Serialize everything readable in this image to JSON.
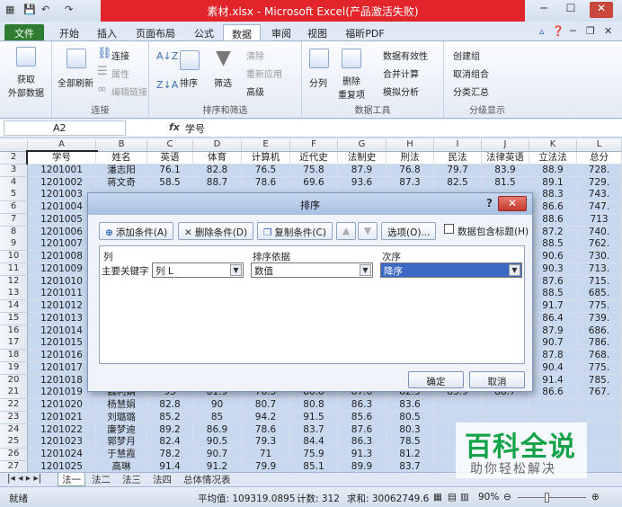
{
  "window": {
    "title": "素材.xlsx - Microsoft Excel(产品激活失败)",
    "qa_save": "💾",
    "qa_undo": "↶",
    "qa_redo": "↷",
    "min": "─",
    "max": "☐",
    "close": "✕"
  },
  "tabs": [
    "文件",
    "开始",
    "插入",
    "页面布局",
    "公式",
    "数据",
    "审阅",
    "视图",
    "福昕PDF"
  ],
  "ribbon": {
    "get_data": [
      "获取",
      "外部数据"
    ],
    "refresh_all": "全部刷新",
    "connections": "连接",
    "properties": "属性",
    "edit_links": "编辑链接",
    "group_connections": "连接",
    "sort": "排序",
    "filter": "筛选",
    "clear": "清除",
    "reapply": "重新应用",
    "advanced": "高级",
    "group_sort_filter": "排序和筛选",
    "split": "分列",
    "remove_dup": [
      "删除",
      "重复项"
    ],
    "validation": "数据有效性",
    "consolidate": "合并计算",
    "whatif": "模拟分析",
    "group_tools": "数据工具",
    "group_btn": "创建组",
    "ungroup_btn": "取消组合",
    "subtotal": "分类汇总",
    "group_outline": "分级显示"
  },
  "formula_bar": {
    "name_box": "A2",
    "fx": "fx",
    "content": "学号"
  },
  "grid": {
    "columns": [
      "A",
      "B",
      "C",
      "D",
      "E",
      "F",
      "G",
      "H",
      "I",
      "J",
      "K",
      "L"
    ],
    "header_row": [
      "学号",
      "姓名",
      "英语",
      "体育",
      "计算机",
      "近代史",
      "法制史",
      "刑法",
      "民法",
      "法律英语",
      "立法法",
      "总分"
    ],
    "rows": [
      [
        "1201001",
        "潘志阳",
        "76.1",
        "82.8",
        "76.5",
        "75.8",
        "87.9",
        "76.8",
        "79.7",
        "83.9",
        "88.9",
        "728."
      ],
      [
        "1201002",
        "蒋文奇",
        "58.5",
        "88.7",
        "78.6",
        "69.6",
        "93.6",
        "87.3",
        "82.5",
        "81.5",
        "89.1",
        "729."
      ],
      [
        "1201003",
        "",
        "",
        "",
        "",
        "",
        "",
        "",
        "",
        "",
        "88.3",
        "743."
      ],
      [
        "1201004",
        "",
        "",
        "",
        "",
        "",
        "",
        "",
        "",
        "",
        "86.6",
        "747."
      ],
      [
        "1201005",
        "",
        "",
        "",
        "",
        "",
        "",
        "",
        "",
        "",
        "88.6",
        "713"
      ],
      [
        "1201006",
        "",
        "",
        "",
        "",
        "",
        "",
        "",
        "",
        "",
        "87.2",
        "740."
      ],
      [
        "1201007",
        "",
        "",
        "",
        "",
        "",
        "",
        "",
        "",
        "",
        "88.5",
        "762."
      ],
      [
        "1201008",
        "",
        "",
        "",
        "",
        "",
        "",
        "",
        "",
        "",
        "90.6",
        "730."
      ],
      [
        "1201009",
        "",
        "",
        "",
        "",
        "",
        "",
        "",
        "",
        "",
        "90.3",
        "713."
      ],
      [
        "1201010",
        "",
        "",
        "",
        "",
        "",
        "",
        "",
        "",
        "",
        "87.6",
        "715."
      ],
      [
        "1201011",
        "",
        "",
        "",
        "",
        "",
        "",
        "",
        "",
        "",
        "88.5",
        "685."
      ],
      [
        "1201012",
        "",
        "",
        "",
        "",
        "",
        "",
        "",
        "",
        "",
        "91.7",
        "775."
      ],
      [
        "1201013",
        "",
        "",
        "",
        "",
        "",
        "",
        "",
        "",
        "",
        "86.4",
        "739."
      ],
      [
        "1201014",
        "",
        "",
        "",
        "",
        "",
        "",
        "",
        "",
        "",
        "87.9",
        "686."
      ],
      [
        "1201015",
        "",
        "",
        "",
        "",
        "",
        "",
        "",
        "",
        "",
        "90.7",
        "786."
      ],
      [
        "1201016",
        "",
        "",
        "",
        "",
        "",
        "",
        "",
        "",
        "",
        "87.8",
        "768."
      ],
      [
        "1201017",
        "",
        "",
        "",
        "",
        "",
        "",
        "",
        "",
        "",
        "90.4",
        "775."
      ],
      [
        "1201018",
        "",
        "",
        "",
        "",
        "",
        "",
        "",
        "",
        "",
        "91.4",
        "785."
      ],
      [
        "1201019",
        "魏利娟",
        "93",
        "81.9",
        "76.5",
        "80.8",
        "87.6",
        "82.5",
        "83.9",
        "88.7",
        "86.6",
        "767."
      ],
      [
        "1201020",
        "杨慧娟",
        "82.8",
        "90",
        "80.7",
        "80.8",
        "86.3",
        "83.6",
        "",
        "",
        "",
        ""
      ],
      [
        "1201021",
        "刘璐璐",
        "85.2",
        "85",
        "94.2",
        "91.5",
        "85.6",
        "80.5",
        "",
        "",
        "",
        ""
      ],
      [
        "1201022",
        "廉梦迪",
        "89.2",
        "86.9",
        "78.6",
        "83.7",
        "87.6",
        "80.3",
        "",
        "",
        "",
        ""
      ],
      [
        "1201023",
        "郭梦月",
        "82.4",
        "90.5",
        "79.3",
        "84.4",
        "86.3",
        "78.5",
        "",
        "",
        "",
        ""
      ],
      [
        "1201024",
        "于慧霞",
        "78.2",
        "90.7",
        "71",
        "75.9",
        "91.3",
        "81.2",
        "",
        "",
        "",
        ""
      ],
      [
        "1201025",
        "高琳",
        "91.4",
        "91.2",
        "79.9",
        "85.1",
        "89.9",
        "83.7",
        "",
        "",
        "",
        ""
      ]
    ]
  },
  "sheets": [
    "法一",
    "法二",
    "法三",
    "法四",
    "总体情况表"
  ],
  "status": {
    "ready": "就绪",
    "average": "平均值: 109319.0895",
    "count": "计数: 312",
    "sum": "求和: 30062749.6",
    "zoom": "90%"
  },
  "dialog": {
    "title": "排序",
    "help": "?",
    "close": "✕",
    "add_level": "添加条件(A)",
    "delete_level": "删除条件(D)",
    "copy_level": "复制条件(C)",
    "move_up": "▲",
    "move_down": "▼",
    "options": "选项(O)...",
    "has_headers": "数据包含标题(H)",
    "col_header": "列",
    "sort_on_header": "排序依据",
    "order_header": "次序",
    "row_label": "主要关键字",
    "column_value": "列 L",
    "sort_on_value": "数值",
    "order_value": "降序",
    "ok": "确定",
    "cancel": "取消"
  },
  "watermark": {
    "main": "百科全说",
    "sub": "助你轻松解决"
  }
}
